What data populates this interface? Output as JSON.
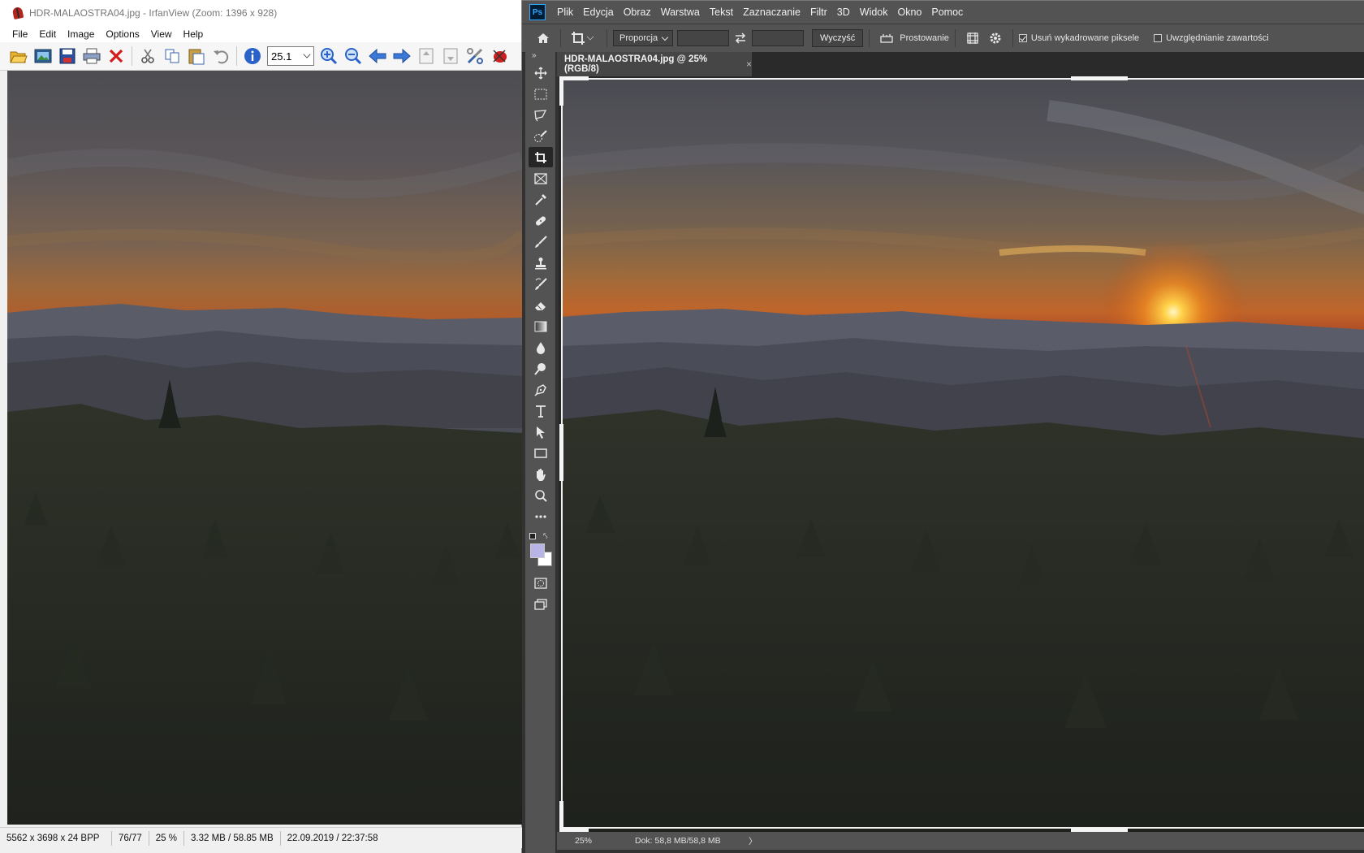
{
  "irfanview": {
    "title": "HDR-MALAOSTRA04.jpg - IrfanView (Zoom: 1396 x 928)",
    "menu": [
      "File",
      "Edit",
      "Image",
      "Options",
      "View",
      "Help"
    ],
    "toolbar": {
      "zoom_value": "25.1",
      "icons": [
        "open-icon",
        "slideshow-icon",
        "save-icon",
        "print-icon",
        "delete-icon",
        "cut-icon",
        "copy-icon",
        "paste-icon",
        "undo-icon",
        "info-icon",
        "zoom-in-icon",
        "zoom-out-icon",
        "previous-icon",
        "next-icon",
        "first-page-icon",
        "last-page-icon",
        "properties-icon",
        "irfanview-logo-icon"
      ]
    },
    "status": {
      "dimensions": "5562 x 3698 x 24 BPP",
      "index": "76/77",
      "zoom": "25 %",
      "size": "3.32 MB / 58.85 MB",
      "datetime": "22.09.2019 / 22:37:58"
    }
  },
  "photoshop": {
    "logo": "Ps",
    "menu": [
      "Plik",
      "Edycja",
      "Obraz",
      "Warstwa",
      "Tekst",
      "Zaznaczanie",
      "Filtr",
      "3D",
      "Widok",
      "Okno",
      "Pomoc"
    ],
    "options": {
      "ratio_select": "Proporcja",
      "clear_button": "Wyczyść",
      "straighten_label": "Prostowanie",
      "delete_cropped_label": "Usuń wykadrowane piksele",
      "delete_cropped_checked": true,
      "content_aware_label": "Uwzględnianie zawartości",
      "content_aware_checked": false
    },
    "tools": [
      "move-tool-icon",
      "marquee-tool-icon",
      "lasso-tool-icon",
      "quick-selection-tool-icon",
      "crop-tool-icon",
      "frame-tool-icon",
      "eyedropper-tool-icon",
      "healing-brush-tool-icon",
      "brush-tool-icon",
      "clone-stamp-tool-icon",
      "history-brush-tool-icon",
      "eraser-tool-icon",
      "gradient-tool-icon",
      "blur-tool-icon",
      "dodge-tool-icon",
      "pen-tool-icon",
      "type-tool-icon",
      "path-selection-tool-icon",
      "rectangle-tool-icon",
      "hand-tool-icon",
      "zoom-tool-icon",
      "more-tools-icon"
    ],
    "active_tool": "crop-tool-icon",
    "tab": {
      "title": "HDR-MALAOSTRA04.jpg @ 25% (RGB/8)",
      "close": "×"
    },
    "status": {
      "zoom": "25%",
      "doc": "Dok: 58,8 MB/58,8 MB",
      "arrow": "〉"
    },
    "colors": {
      "foreground": "#b9b4e6",
      "background": "#ffffff"
    }
  }
}
